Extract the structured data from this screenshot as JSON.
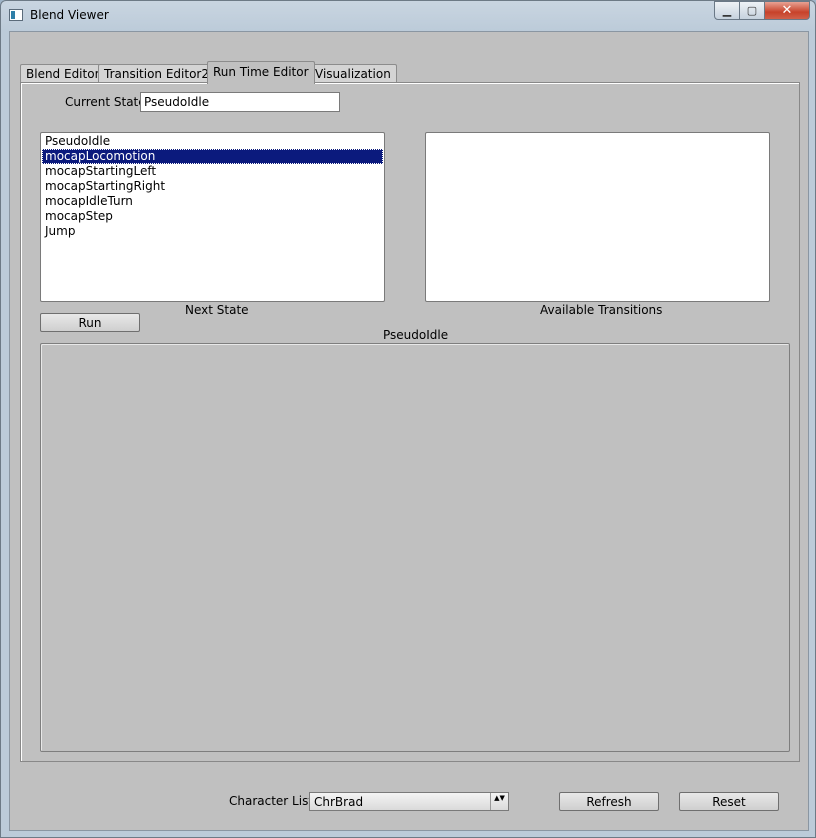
{
  "window": {
    "title": "Blend Viewer"
  },
  "title_buttons": {
    "minimize": "▁",
    "maximize": "▢",
    "close": "✕"
  },
  "tabs": [
    {
      "label": "Blend Editor"
    },
    {
      "label": "Transition Editor2"
    },
    {
      "label": "Run Time Editor",
      "active": true
    },
    {
      "label": "Visualization"
    }
  ],
  "current_state": {
    "label": "Current State",
    "value": "PseudoIdle"
  },
  "next_state": {
    "label": "Next State",
    "items": [
      "PseudoIdle",
      "mocapLocomotion",
      "mocapStartingLeft",
      "mocapStartingRight",
      "mocapIdleTurn",
      "mocapStep",
      "Jump"
    ],
    "selected_index": 1
  },
  "available_transitions": {
    "label": "Available Transitions",
    "items": []
  },
  "run_button": {
    "label": "Run"
  },
  "state_view": {
    "label": "PseudoIdle"
  },
  "character_list": {
    "label": "Character List",
    "value": "ChrBrad",
    "arrow": "▲▼"
  },
  "refresh_button": {
    "label": "Refresh"
  },
  "reset_button": {
    "label": "Reset"
  }
}
